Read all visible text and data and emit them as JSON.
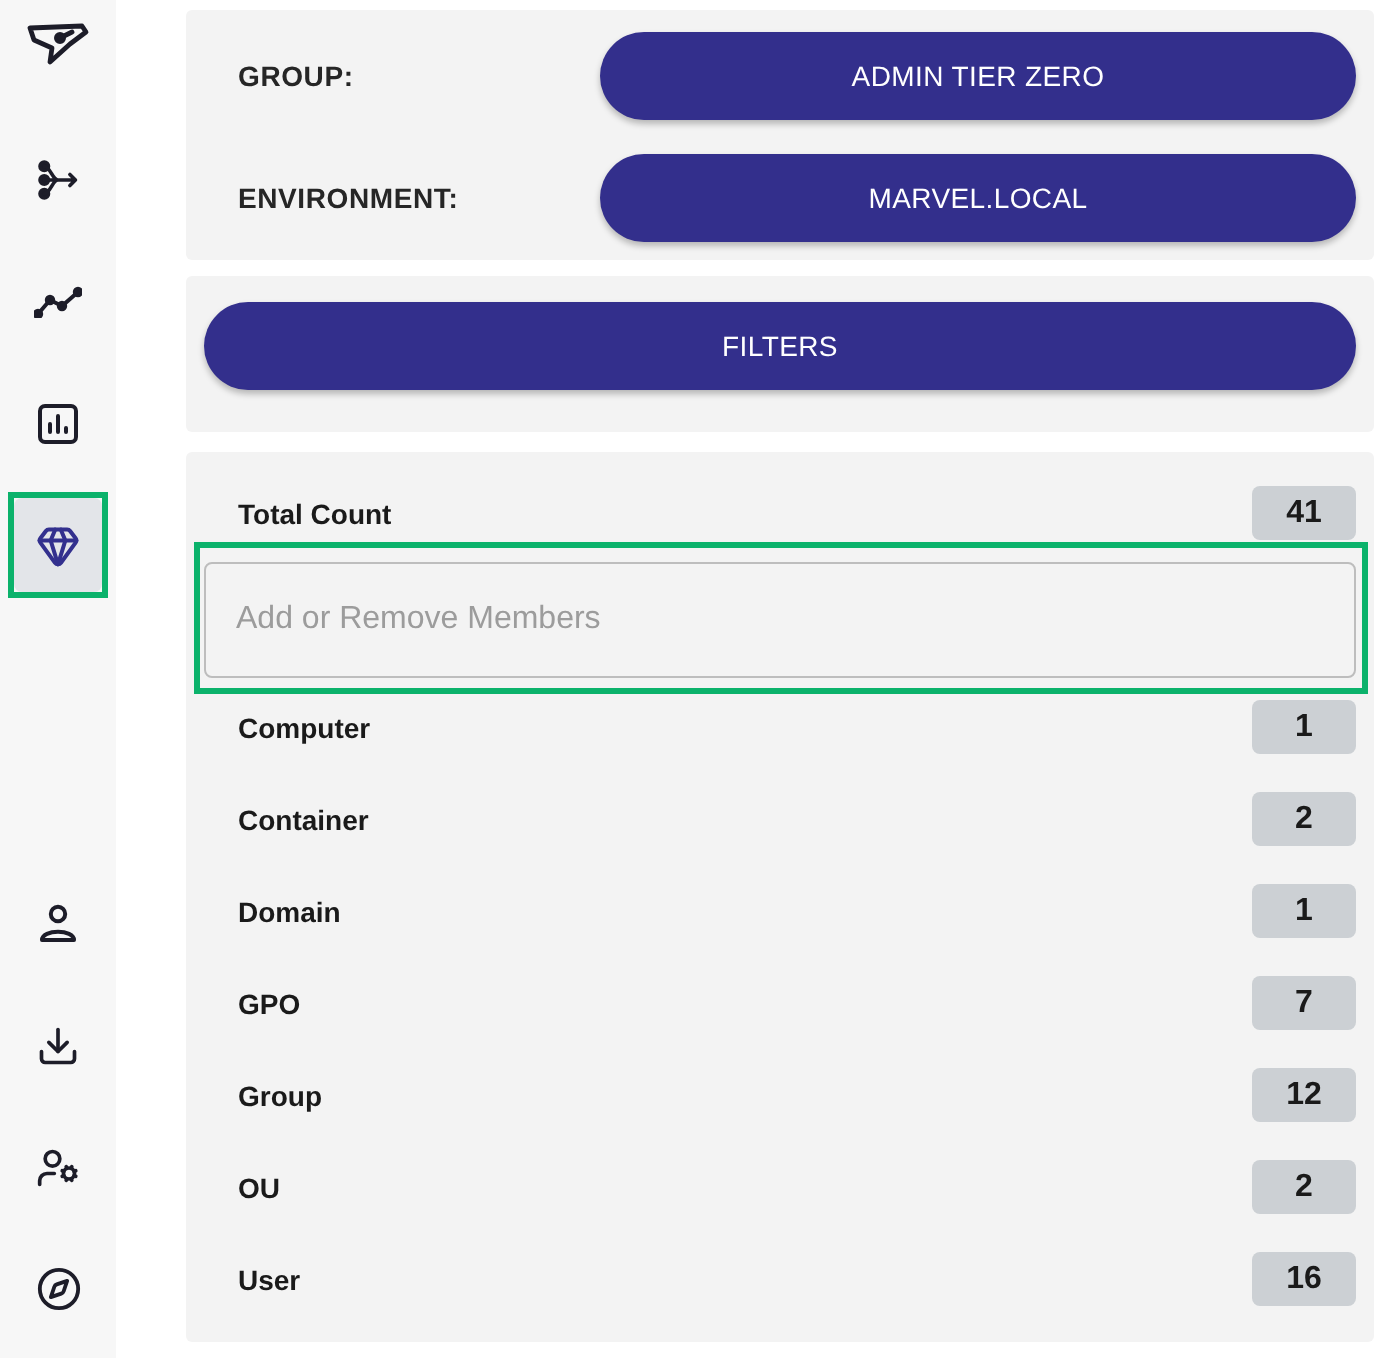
{
  "sidebar": {
    "top_items": [
      {
        "selected": false,
        "highlighted": false
      },
      {
        "selected": false,
        "highlighted": false
      },
      {
        "selected": false,
        "highlighted": false
      },
      {
        "selected": true,
        "highlighted": true
      }
    ],
    "bottom_items": [
      {
        "selected": false
      },
      {
        "selected": false
      },
      {
        "selected": false
      },
      {
        "selected": false
      }
    ]
  },
  "selectors": [
    {
      "label": "GROUP:",
      "value": "ADMIN TIER ZERO"
    },
    {
      "label": "ENVIRONMENT:",
      "value": "MARVEL.LOCAL"
    }
  ],
  "filters_button": "FILTERS",
  "counts": {
    "total": {
      "label": "Total Count",
      "count": "41"
    },
    "member_field": {
      "placeholder": "Add or Remove Members",
      "highlighted": true
    },
    "rows": [
      {
        "label": "Computer",
        "count": "1"
      },
      {
        "label": "Container",
        "count": "2"
      },
      {
        "label": "Domain",
        "count": "1"
      },
      {
        "label": "GPO",
        "count": "7"
      },
      {
        "label": "Group",
        "count": "12"
      },
      {
        "label": "OU",
        "count": "2"
      },
      {
        "label": "User",
        "count": "16"
      }
    ]
  }
}
